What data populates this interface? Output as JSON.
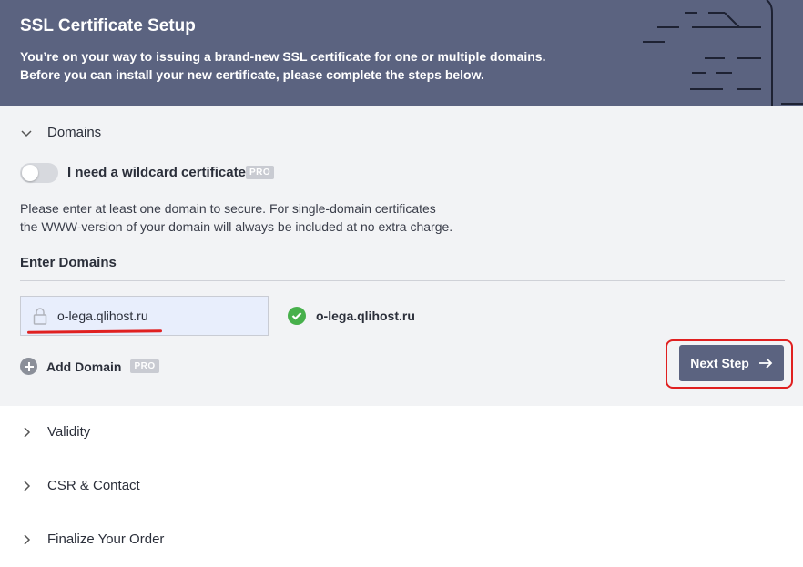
{
  "header": {
    "title": "SSL Certificate Setup",
    "subtitle_line1": "You’re on your way to issuing a brand-new SSL certificate for one or multiple domains.",
    "subtitle_line2": "Before you can install your new certificate, please complete the steps below."
  },
  "domains": {
    "title": "Domains",
    "wildcard_label": "I need a wildcard certificate",
    "wildcard_enabled": false,
    "pro_badge": "PRO",
    "description_line1": "Please enter at least one domain to secure. For single-domain certificates",
    "description_line2": "the WWW-version of your domain will always be included at no extra charge.",
    "enter_label": "Enter Domains",
    "input_value": "o-lega.qlihost.ru",
    "validated_domain": "o-lega.qlihost.ru",
    "add_domain_label": "Add Domain",
    "next_step_label": "Next Step"
  },
  "sections": [
    {
      "title": "Validity"
    },
    {
      "title": "CSR & Contact"
    },
    {
      "title": "Finalize Your Order"
    }
  ],
  "colors": {
    "header_bg": "#5b6380",
    "panel_bg": "#f2f3f5",
    "accent_red": "#e02020",
    "success_green": "#47b04b"
  }
}
